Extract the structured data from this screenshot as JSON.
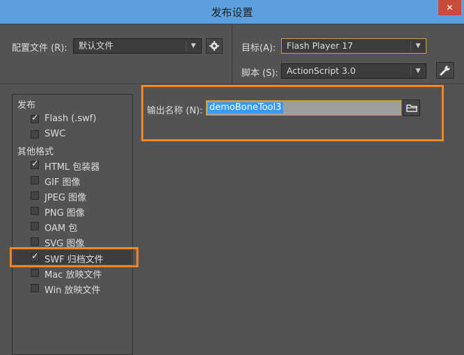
{
  "window": {
    "title": "发布设置",
    "close": "✕"
  },
  "profile": {
    "label": "配置文件 (R):",
    "value": "默认文件"
  },
  "target": {
    "label": "目标(A):",
    "value": "Flash Player 17"
  },
  "script": {
    "label": "脚本 (S):",
    "value": "ActionScript 3.0"
  },
  "output": {
    "label": "输出名称 (N):",
    "value": "demoBoneTool3"
  },
  "tree": {
    "publish_header": "发布",
    "other_header": "其他格式",
    "items": [
      {
        "label": "Flash (.swf)",
        "checked": true
      },
      {
        "label": "SWC",
        "checked": false
      },
      {
        "label": "HTML 包装器",
        "checked": true
      },
      {
        "label": "GIF 图像",
        "checked": false
      },
      {
        "label": "JPEG 图像",
        "checked": false
      },
      {
        "label": "PNG 图像",
        "checked": false
      },
      {
        "label": "OAM 包",
        "checked": false
      },
      {
        "label": "SVG 图像",
        "checked": false
      },
      {
        "label": "SWF 归档文件",
        "checked": true
      },
      {
        "label": "Mac 放映文件",
        "checked": false
      },
      {
        "label": "Win 放映文件",
        "checked": false
      }
    ]
  },
  "colors": {
    "accent": "#5ba0dc",
    "highlight": "#f58520",
    "background": "#535353"
  },
  "icons": {
    "gear": "gear-icon",
    "wrench": "wrench-icon",
    "folder": "folder-icon"
  }
}
